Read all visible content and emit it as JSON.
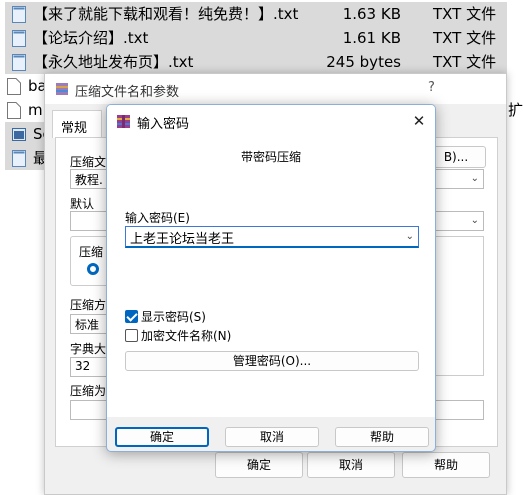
{
  "files": [
    {
      "name": "【来了就能下载和观看！纯免费！】.txt",
      "size": "1.63 KB",
      "type": "TXT 文件",
      "selected": true
    },
    {
      "name": "【论坛介绍】.txt",
      "size": "1.61 KB",
      "type": "TXT 文件",
      "selected": true
    },
    {
      "name": "【永久地址发布页】.txt",
      "size": "245 bytes",
      "type": "TXT 文件",
      "selected": true
    },
    {
      "name": "ba",
      "size": "",
      "type": "",
      "selected": false
    },
    {
      "name": "mi",
      "size": "",
      "type": "扩展",
      "selected": false
    },
    {
      "name": "Sc",
      "size": "",
      "type": "",
      "selected": true
    },
    {
      "name": "最",
      "size": "",
      "type": "",
      "selected": true
    }
  ],
  "archive_dialog": {
    "title": "压缩文件名和参数",
    "help": "?",
    "tab": "常规",
    "label_archive_name": "压缩文",
    "archive_name_value": "教程.",
    "browse_button": "B)...",
    "label_default": "默认",
    "label_format": "压缩",
    "label_method": "压缩方",
    "method_value": "标准",
    "label_dict": "字典大",
    "dict_value": "32",
    "label_split": "压缩为",
    "ok": "确定",
    "cancel": "取消",
    "help_button": "帮助"
  },
  "password_dialog": {
    "title": "输入密码",
    "close": "✕",
    "heading": "带密码压缩",
    "field_label": "输入密码(E)",
    "password_value": "上老王论坛当老王",
    "show_password_label": "显示密码(S)",
    "show_password_checked": true,
    "encrypt_names_label": "加密文件名称(N)",
    "encrypt_names_checked": false,
    "manage_button": "管理密码(O)...",
    "ok": "确定",
    "cancel": "取消",
    "help": "帮助"
  },
  "icons": {
    "file": "text-file-icon",
    "app": "winrar-icon"
  },
  "colors": {
    "accent": "#0067c0",
    "selection": "#dadada"
  }
}
